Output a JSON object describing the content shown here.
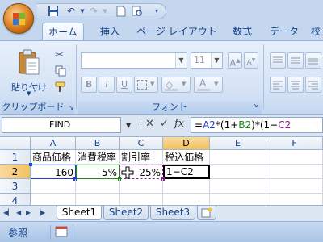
{
  "quick_access": {
    "icons": [
      "save-icon",
      "undo-icon",
      "redo-icon",
      "new-document-icon",
      "print-preview-icon",
      "customize-icon"
    ]
  },
  "tabs": [
    {
      "label": "ホーム",
      "active": true
    },
    {
      "label": "挿入"
    },
    {
      "label": "ページ レイアウト"
    },
    {
      "label": "数式"
    },
    {
      "label": "データ"
    },
    {
      "label": "校"
    }
  ],
  "ribbon": {
    "clipboard": {
      "paste_label": "貼り付け",
      "group_label": "クリップボード"
    },
    "font": {
      "font_name": "",
      "font_size": "11",
      "group_label": "フォント",
      "bold": "B",
      "italic": "I",
      "underline": "U"
    }
  },
  "formula_bar": {
    "name_box": "FIND",
    "cancel": "✕",
    "enter": "✓",
    "fx": "fx",
    "formula_parts": [
      {
        "text": "=",
        "color": "#000000"
      },
      {
        "text": "A2",
        "color": "#1f3fd0"
      },
      {
        "text": "*(1+",
        "color": "#000000"
      },
      {
        "text": "B2",
        "color": "#1a8a1a"
      },
      {
        "text": ")*(1−",
        "color": "#000000"
      },
      {
        "text": "C2",
        "color": "#8a1a8a"
      }
    ]
  },
  "sheet": {
    "columns": [
      "A",
      "B",
      "C",
      "D",
      "E",
      "F"
    ],
    "rows": [
      "1",
      "2",
      "3",
      "4"
    ],
    "header_row": [
      "商品価格",
      "消費税率",
      "割引率",
      "税込価格"
    ],
    "data_row": [
      "160",
      "5%",
      "25%",
      "1−C2"
    ]
  },
  "sheet_tabs": [
    "Sheet1",
    "Sheet2",
    "Sheet3"
  ],
  "status": {
    "mode": "参照"
  },
  "colors": {
    "ref_a2": "#1f3fd0",
    "ref_b2": "#1a8a1a",
    "ref_c2": "#8a1a8a",
    "accent": "#15428b"
  }
}
